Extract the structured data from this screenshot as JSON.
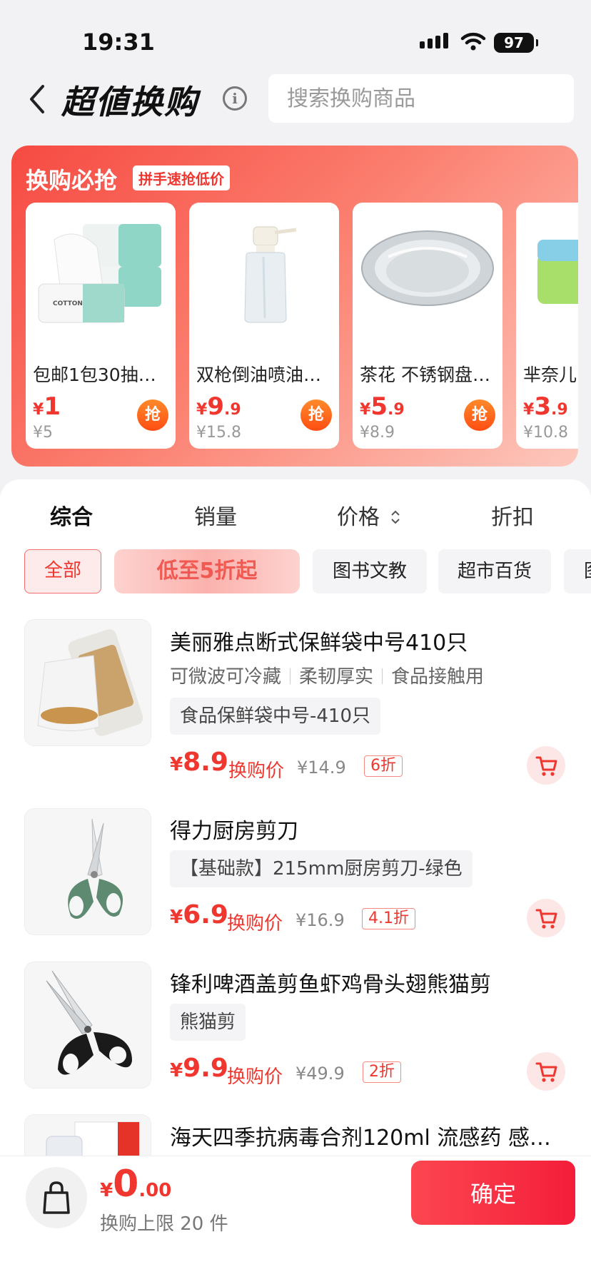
{
  "status_bar": {
    "time": "19:31",
    "battery": "97"
  },
  "header": {
    "title": "超値换购",
    "search_placeholder": "搜索换购商品"
  },
  "promo": {
    "title": "换购必抢",
    "tag": "拼手速抢低价",
    "grab_label": "抢",
    "items": [
      {
        "name": "包邮1包30抽…",
        "currency": "¥",
        "price_big": "1",
        "price_small": "",
        "original": "¥5"
      },
      {
        "name": "双枪倒油喷油…",
        "currency": "¥",
        "price_big": "9",
        "price_small": ".9",
        "original": "¥15.8"
      },
      {
        "name": "茶花 不锈钢盘…",
        "currency": "¥",
        "price_big": "5",
        "price_small": ".9",
        "original": "¥8.9"
      },
      {
        "name": "芈奈儿",
        "currency": "¥",
        "price_big": "3",
        "price_small": ".9",
        "original": "¥10.8"
      }
    ]
  },
  "sort_tabs": [
    "综合",
    "销量",
    "价格",
    "折扣"
  ],
  "categories": [
    "全部",
    "低至5折起",
    "图书文教",
    "超市百货",
    "图"
  ],
  "products": [
    {
      "name": "美丽雅点断式保鲜袋中号410只",
      "features": [
        "可微波可冷藏",
        "柔韧厚实",
        "食品接触用"
      ],
      "spec": "食品保鲜袋中号-410只",
      "currency": "¥",
      "price": "8.9",
      "price_label": "换购价",
      "original": "¥14.9",
      "discount": "6折"
    },
    {
      "name": "得力厨房剪刀",
      "features": [],
      "spec": "【基础款】215mm厨房剪刀-绿色",
      "currency": "¥",
      "price": "6.9",
      "price_label": "换购价",
      "original": "¥16.9",
      "discount": "4.1折"
    },
    {
      "name": "锋利啤酒盖剪鱼虾鸡骨头翅熊猫剪",
      "features": [],
      "spec": "熊猫剪",
      "currency": "¥",
      "price": "9.9",
      "price_label": "换购价",
      "original": "¥49.9",
      "discount": "2折"
    },
    {
      "name": "海天四季抗病毒合剂120ml 流感药 感…"
    }
  ],
  "bottom": {
    "currency": "¥",
    "total_big": "0",
    "total_small": ".00",
    "limit": "换购上限 20 件",
    "confirm": "确定"
  },
  "colors": {
    "accent": "#f0372f",
    "confirm": "#f41e3a",
    "promo_start": "#f64a42"
  }
}
